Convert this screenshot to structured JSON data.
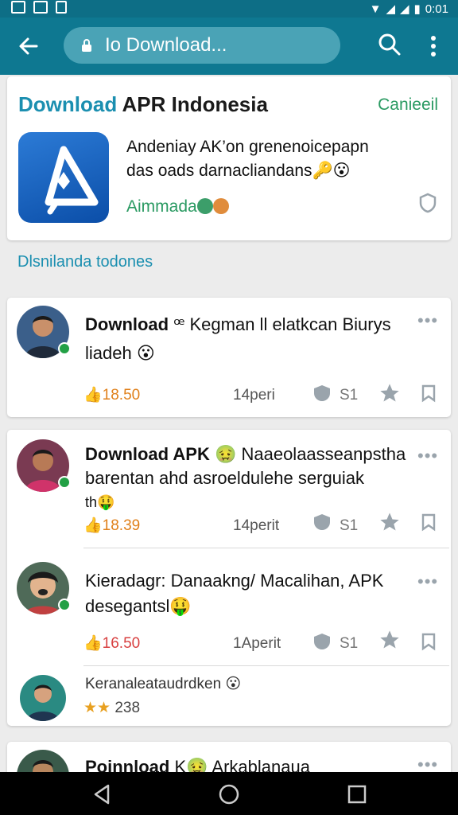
{
  "status_bar": {
    "left_icons": [
      "image-icon",
      "image-icon",
      "flag-icon"
    ],
    "time": "0:01"
  },
  "app_bar": {
    "search_text": "Io Download..."
  },
  "hero": {
    "title_accent": "Download",
    "title_rest": " APR Indonesia",
    "action": "Canieeil",
    "desc_line1": "Andeniay AK’on grenenoicepapn",
    "desc_line2": "das oads darnacliandans🔑😮",
    "tag": "Aimmada"
  },
  "section_label": "Dlsnilanda todones",
  "posts": [
    {
      "title_bold": "Download",
      "title_rest": " ꟹ Kegman ll elatkcan Biurys",
      "line2": "liadeh 😮",
      "line3": "",
      "metric": "18.50",
      "time": "14peri",
      "likes": "S1",
      "avatar_color": "#3b5f8a"
    },
    {
      "title_bold": "Download APK",
      "title_rest": " 🤢 Naaeolaasseanpstha",
      "line2": "barentan ahd asroeldulehe serguiak",
      "line3": "th🤑",
      "metric": "18.39",
      "time": "14perit",
      "likes": "S1",
      "avatar_color": "#7a3a52"
    },
    {
      "title_bold": "",
      "title_rest": "Kieradagr: Danaakng/ Macalihan, APK",
      "line2": "desegantsl🤑",
      "line3": "",
      "metric": "16.50",
      "time": "1Aperit",
      "likes": "S1",
      "avatar_color": "#4f6a58"
    }
  ],
  "comment": {
    "text": "Keranaleataudrdken 😮",
    "rating": "238"
  },
  "last_post": {
    "title_bold": "Poinnload",
    "title_rest": " K🤢 Arkablanaua"
  }
}
